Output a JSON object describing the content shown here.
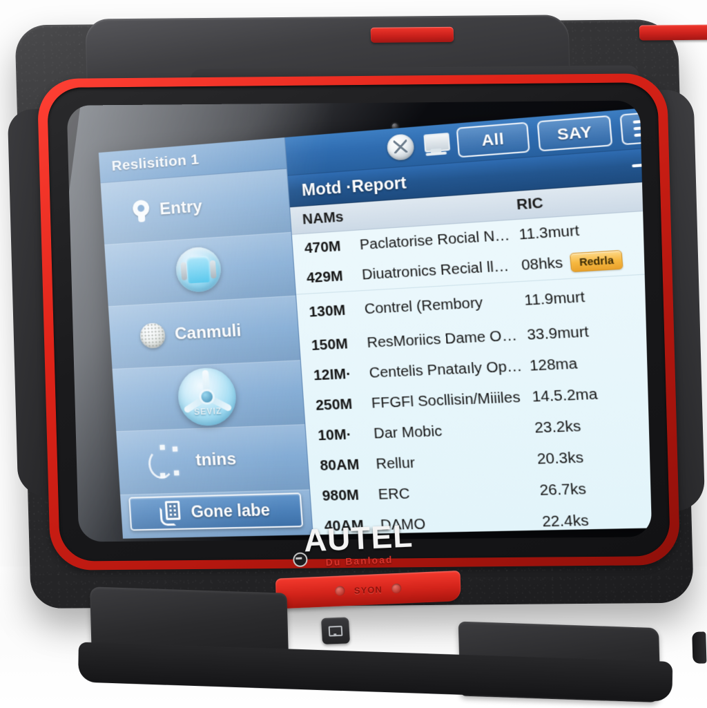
{
  "device": {
    "brand": "AUTEL",
    "brand_tagline": "Du Banload",
    "bottom_strip_text": "SYON",
    "colors": {
      "accent_red": "#d2231a",
      "shell_dark": "#2c2c2e",
      "ui_blue": "#2f6cb0",
      "badge_orange": "#f6b840"
    },
    "icons": {
      "camera": "camera-dot-icon",
      "usb": "usb-port-icon",
      "registered": "registered-trademark-icon"
    }
  },
  "ui": {
    "sidebar": {
      "title": "Reslisition 1",
      "items": [
        {
          "label": "Entry",
          "icon": "pin-icon"
        },
        {
          "label": "",
          "icon": "seat-orb-icon"
        },
        {
          "label": "Canmuli",
          "icon": "golf-ball-icon"
        },
        {
          "label": "SEVIZ",
          "icon": "disc-fan-icon"
        },
        {
          "label": "tnins",
          "icon": "network-nodes-icon"
        }
      ],
      "bottom_button": {
        "label": "Gone labe",
        "icon": "qr-scan-icon"
      }
    },
    "toolbar": {
      "orb_icon": "compass-orb-icon",
      "monitor_icon": "monitor-icon",
      "all_label": "All",
      "say_label": "SAY",
      "menu_icon": "hamburger-menu-icon"
    },
    "report": {
      "title": "Motd ·Report",
      "forward_icon": "arrow-right-icon",
      "columns": {
        "name": "NAMs",
        "ric": "RIC"
      },
      "rows": [
        {
          "code": "470M",
          "name": "Paclatorise Rocial Nleuer",
          "ric": "11.3murt",
          "badge": ""
        },
        {
          "code": "429M",
          "name": "Diuatronics Recial lleter",
          "ric": "08hks",
          "badge": "Redrla"
        },
        {
          "code": "130M",
          "name": "Contrel (Rembory",
          "ric": "11.9murt",
          "badge": ""
        },
        {
          "code": "150M",
          "name": "ResMoriics Dame O/SM",
          "ric": "33.9murt",
          "badge": ""
        },
        {
          "code": "12IM·",
          "name": "Centelis Pnataıly Optena Polic",
          "ric": "128ma",
          "badge": ""
        },
        {
          "code": "250M",
          "name": "FFGFl Socllisin/Miiiles",
          "ric": "14.5.2ma",
          "badge": ""
        },
        {
          "code": "10M·",
          "name": "Dar Mobic",
          "ric": "23.2ks",
          "badge": ""
        },
        {
          "code": "80AM",
          "name": "Rellur",
          "ric": "20.3ks",
          "badge": ""
        },
        {
          "code": "980M",
          "name": "ERC",
          "ric": "26.7ks",
          "badge": ""
        },
        {
          "code": "40AM",
          "name": "DAMO",
          "ric": "22.4ks",
          "badge": ""
        }
      ],
      "scrollbar": {
        "up_icon": "scroll-up-arrow",
        "down_icon": "scroll-down-arrow"
      }
    }
  }
}
